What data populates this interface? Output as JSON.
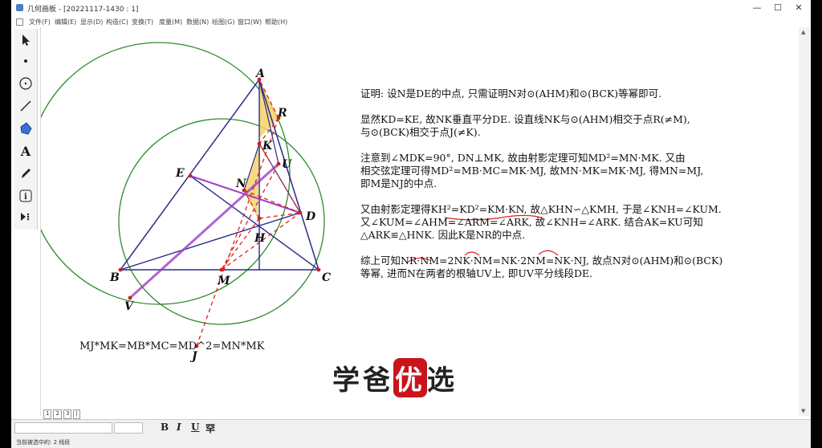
{
  "window": {
    "title": "几何画板 - [20221117-1430 : 1]",
    "minimize": "—",
    "maximize": "☐",
    "close": "✕"
  },
  "menu": [
    "文件(F)",
    "编辑(E)",
    "显示(D)",
    "构造(C)",
    "变换(T)",
    "度量(M)",
    "数据(N)",
    "绘图(G)",
    "窗口(W)",
    "帮助(H)"
  ],
  "tools": [
    "arrow-select-tool",
    "point-tool",
    "compass-tool",
    "straightedge-tool",
    "polygon-tool",
    "text-tool",
    "marker-tool",
    "information-tool",
    "custom-tool"
  ],
  "text_tool_glyph": "A",
  "info_tool_glyph": "i",
  "points": {
    "A": "A",
    "R": "R",
    "K": "K",
    "U": "U",
    "E": "E",
    "N": "N",
    "D": "D",
    "H": "H",
    "B": "B",
    "M": "M",
    "C": "C",
    "V": "V",
    "J": "J"
  },
  "proof": {
    "p1": "证明: 设N是DE的中点, 只需证明N对⊙(AHM)和⊙(BCK)等幂即可.",
    "p2a": "显然KD=KE, 故NK垂直平分DE. 设直线NK与⊙(AHM)相交于点R(≠M),",
    "p2b": "与⊙(BCK)相交于点J(≠K).",
    "p3a": "注意到∠MDK=90°, DN⊥MK, 故由射影定理可知MD²=MN·MK. 又由",
    "p3b": "相交弦定理可得MD²=MB·MC=MK·MJ, 故MN·MK=MK·MJ, 得MN=MJ,",
    "p3c": "即M是NJ的中点.",
    "p4a": "又由射影定理得KH²=KD²=KM·KN, 故△KHN∽△KMH, 于是∠KNH=∠KUM.",
    "p4b": "又∠KUM=∠AHM=∠ARM=∠ARK, 故∠KNH=∠ARK. 结合AK=KU可知",
    "p4c": "△ARK≌△HNK. 因此K是NR的中点.",
    "p5a": "综上可知NR·NM=2NK·NM=NK·2NM=NK·NJ, 故点N对⊙(AHM)和⊙(BCK)",
    "p5b": "等幂, 进而N在两者的根轴UV上, 即UV平分线段DE."
  },
  "formula": "MJ*MK=MB*MC=MD^2=MN*MK",
  "watermark": {
    "pre": "学爸",
    "hl": "优",
    "post": "选"
  },
  "pagetabs": [
    "1",
    "2",
    "3",
    "|"
  ],
  "textbar": {
    "bold": "B",
    "italic": "I",
    "underline": "U",
    "extra": "罕"
  },
  "status": "当前被选中的: 2 线段",
  "colors": {
    "triangle": "#2a2a8a",
    "circle": "#2e8b2e",
    "dashed": "#e02020",
    "purple": "#9b3fc9",
    "fill": "#f5d36b"
  }
}
